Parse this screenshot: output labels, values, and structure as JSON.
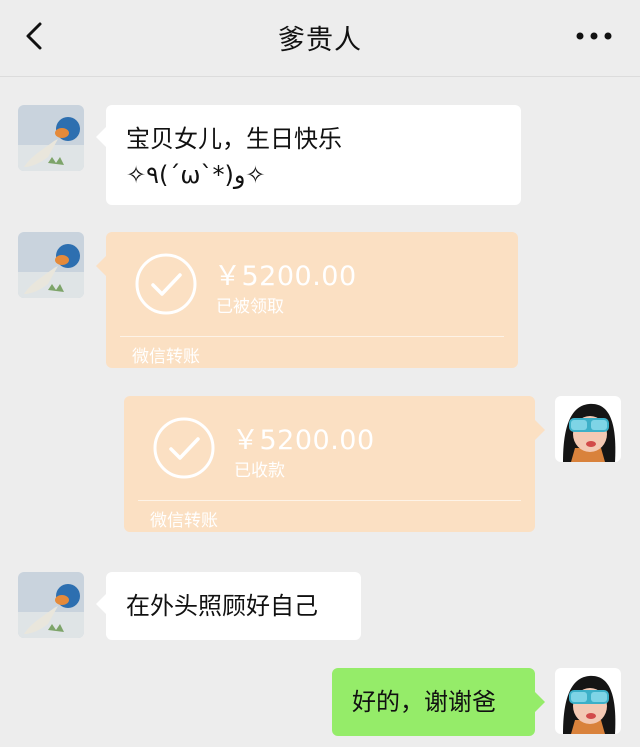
{
  "header": {
    "title": "爹贵人",
    "back_icon": "chevron-left-icon",
    "more_icon": "more-dots-icon"
  },
  "messages": [
    {
      "text_line1": "宝贝女儿，生日快乐",
      "text_line2": "✧٩(ˊωˋ*)و✧"
    },
    {
      "amount": "￥5200.00",
      "status": "已被领取",
      "footer": "微信转账"
    },
    {
      "amount": "￥5200.00",
      "status": "已收款",
      "footer": "微信转账"
    },
    {
      "text": "在外头照顾好自己"
    },
    {
      "text": "好的，谢谢爸"
    }
  ],
  "colors": {
    "background": "#ededed",
    "bubble_white": "#ffffff",
    "bubble_green": "#95ec69",
    "transfer": "#fbe0c3"
  }
}
